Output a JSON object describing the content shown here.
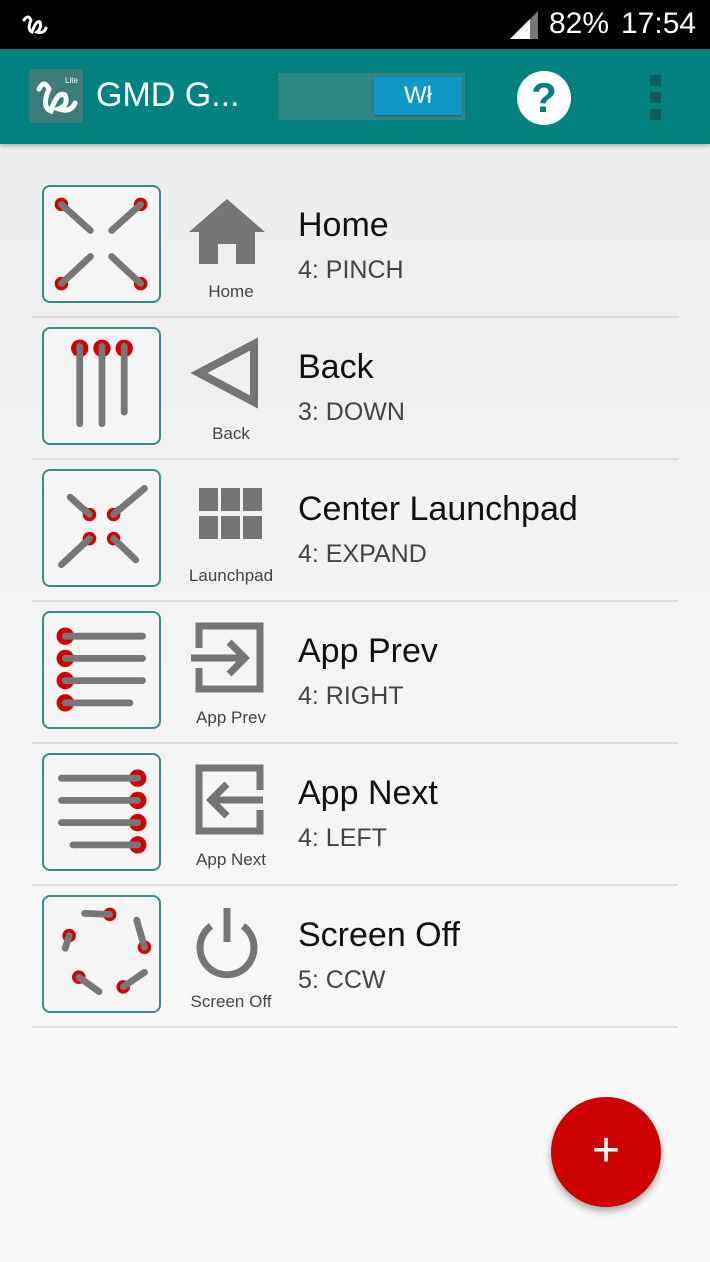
{
  "status_bar": {
    "battery": "82%",
    "time": "17:54"
  },
  "app_bar": {
    "title": "GMD G...",
    "toggle_label": "Wł",
    "help_label": "?"
  },
  "gestures": [
    {
      "title": "Home",
      "gesture": "4: PINCH",
      "action_label": "Home",
      "action_icon": "home-icon",
      "gesture_icon": "pinch-gesture-icon"
    },
    {
      "title": "Back",
      "gesture": "3: DOWN",
      "action_label": "Back",
      "action_icon": "back-triangle-icon",
      "gesture_icon": "swipe-down-gesture-icon"
    },
    {
      "title": "Center Launchpad",
      "gesture": "4: EXPAND",
      "action_label": "Launchpad",
      "action_icon": "launchpad-grid-icon",
      "gesture_icon": "expand-gesture-icon"
    },
    {
      "title": "App Prev",
      "gesture": "4: RIGHT",
      "action_label": "App Prev",
      "action_icon": "enter-arrow-icon",
      "gesture_icon": "swipe-right-gesture-icon"
    },
    {
      "title": "App Next",
      "gesture": "4: LEFT",
      "action_label": "App Next",
      "action_icon": "exit-arrow-icon",
      "gesture_icon": "swipe-left-gesture-icon"
    },
    {
      "title": "Screen Off",
      "gesture": "5: CCW",
      "action_label": "Screen Off",
      "action_icon": "power-icon",
      "gesture_icon": "rotate-ccw-gesture-icon"
    }
  ],
  "fab": {
    "label": "+"
  },
  "colors": {
    "primary": "#018281",
    "accent": "#cc0000",
    "toggle_on": "#0f98c4"
  }
}
